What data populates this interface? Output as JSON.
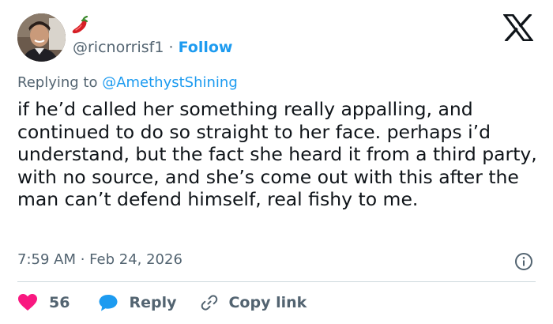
{
  "user": {
    "handle": "@ricnorrisf1",
    "separator": "·",
    "follow_label": "Follow",
    "emoji_icon": "hot-pepper-emoji"
  },
  "reply_context": {
    "prefix": "Replying to ",
    "mention": "@AmethystShining"
  },
  "tweet": {
    "text": "if he’d called her something really appalling, and continued to do so straight to her face. perhaps i’d understand, but the fact she heard it from a third party, with no source, and she’s come out with this after the man can’t defend himself, real fishy to me.",
    "timestamp": "7:59 AM · Feb 24, 2026"
  },
  "actions": {
    "like_count": "56",
    "reply_label": "Reply",
    "copy_link_label": "Copy link"
  },
  "colors": {
    "accent": "#1d9bf0",
    "like": "#f91880",
    "secondary_text": "#536471",
    "divider": "#cfd9de"
  }
}
